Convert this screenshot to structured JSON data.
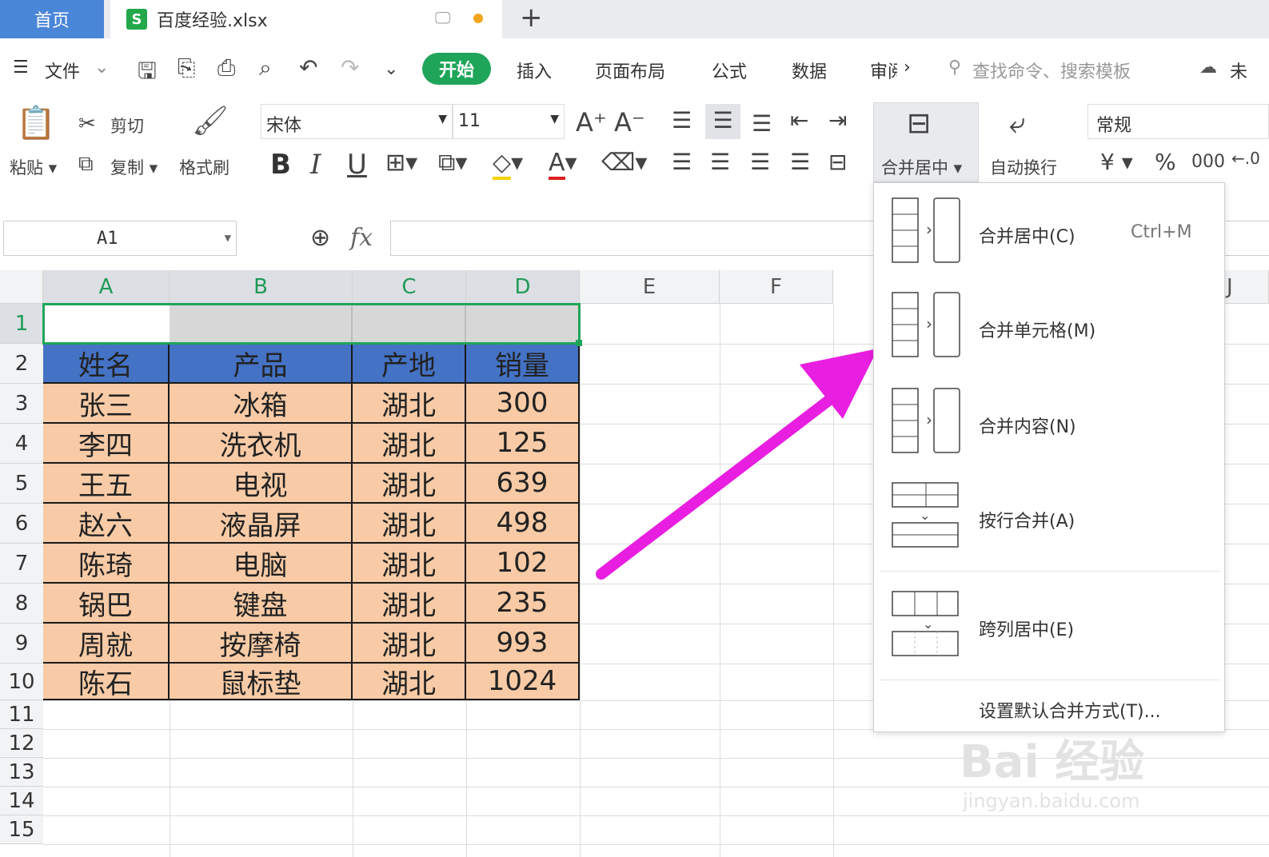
{
  "titlebar": {
    "home_tab": "首页",
    "file_tab": "百度经验.xlsx",
    "s_logo": "S",
    "new_tab": "+"
  },
  "menu": {
    "file": "文件",
    "tabs": [
      "开始",
      "插入",
      "页面布局",
      "公式",
      "数据",
      "审阅"
    ],
    "more": "›",
    "search_placeholder": "查找命令、搜索模板",
    "cloud": "未"
  },
  "toolbar": {
    "paste": "粘贴",
    "cut": "剪切",
    "copy": "复制",
    "format_painter": "格式刷",
    "font_name": "宋体",
    "font_size": "11",
    "bold": "B",
    "italic": "I",
    "underline": "U",
    "merge_center": "合并居中",
    "auto_wrap": "自动换行",
    "number_format": "常规",
    "currency": "¥",
    "percent": "%",
    "thousands": "000"
  },
  "formula": {
    "name_box": "A1",
    "fx": "fx",
    "value": ""
  },
  "sheet": {
    "columns": [
      "A",
      "B",
      "C",
      "D",
      "E",
      "F",
      "J"
    ],
    "rows": [
      "1",
      "2",
      "3",
      "4",
      "5",
      "6",
      "7",
      "8",
      "9",
      "10",
      "11",
      "12",
      "13",
      "14",
      "15"
    ],
    "header": [
      "姓名",
      "产品",
      "产地",
      "销量"
    ],
    "data": [
      [
        "张三",
        "冰箱",
        "湖北",
        "300"
      ],
      [
        "李四",
        "洗衣机",
        "湖北",
        "125"
      ],
      [
        "王五",
        "电视",
        "湖北",
        "639"
      ],
      [
        "赵六",
        "液晶屏",
        "湖北",
        "498"
      ],
      [
        "陈琦",
        "电脑",
        "湖北",
        "102"
      ],
      [
        "锅巴",
        "键盘",
        "湖北",
        "235"
      ],
      [
        "周就",
        "按摩椅",
        "湖北",
        "993"
      ],
      [
        "陈石",
        "鼠标垫",
        "湖北",
        "1024"
      ]
    ]
  },
  "merge_menu": {
    "items": [
      {
        "label": "合并居中(C)",
        "shortcut": "Ctrl+M"
      },
      {
        "label": "合并单元格(M)",
        "shortcut": ""
      },
      {
        "label": "合并内容(N)",
        "shortcut": ""
      },
      {
        "label": "按行合并(A)",
        "shortcut": ""
      },
      {
        "label": "跨列居中(E)",
        "shortcut": ""
      }
    ],
    "default_setting": "设置默认合并方式(T)..."
  },
  "watermark": {
    "logo": "Bai 经验",
    "url": "jingyan.baidu.com"
  },
  "colors": {
    "accent": "#1fa55a",
    "header_fill": "#4472c4",
    "data_fill": "#f8cba6",
    "arrow": "#e81ee0",
    "home_tab": "#4a86d8"
  }
}
